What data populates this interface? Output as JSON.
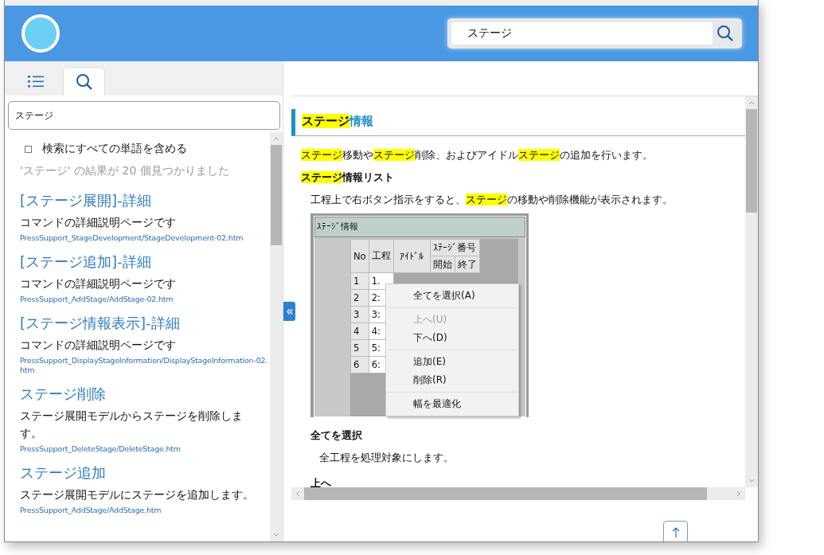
{
  "header": {
    "search": {
      "value": "ステージ"
    }
  },
  "sidebar": {
    "tabs": [
      {
        "kind": "contents",
        "selected": false
      },
      {
        "kind": "search",
        "selected": true
      }
    ],
    "search_field": {
      "value": "ステージ"
    },
    "all_words": {
      "label": "検索にすべての単語を含める",
      "checked": false
    },
    "result_count": "'ステージ' の結果が 20 個見つかりました",
    "results": [
      {
        "title": "[ステージ展開]-詳細",
        "description": "コマンドの詳細説明ページです",
        "path": "PressSupport_StageDevelopment/StageDevelopment-02.htm"
      },
      {
        "title": "[ステージ追加]-詳細",
        "description": "コマンドの詳細説明ページです",
        "path": "PressSupport_AddStage/AddStage-02.htm"
      },
      {
        "title": "[ステージ情報表示]-詳細",
        "description": "コマンドの詳細説明ページです",
        "path": "PressSupport_DisplayStageInformation/DisplayStageInformation-02.htm"
      },
      {
        "title": "ステージ削除",
        "description": "ステージ展開モデルからステージを削除します。",
        "path": "PressSupport_DeleteStage/DeleteStage.htm"
      },
      {
        "title": "ステージ追加",
        "description": "ステージ展開モデルにステージを追加します。",
        "path": "PressSupport_AddStage/AddStage.htm"
      }
    ]
  },
  "article": {
    "heading": [
      {
        "text": "ステージ",
        "highlight": true
      },
      {
        "text": "情報",
        "highlight": false
      }
    ],
    "intro": [
      {
        "text": "ステージ",
        "highlight": true
      },
      {
        "text": "移動や",
        "highlight": false
      },
      {
        "text": "ステージ",
        "highlight": true
      },
      {
        "text": "削除、およびアイドル",
        "highlight": false
      },
      {
        "text": "ステージ",
        "highlight": true
      },
      {
        "text": "の追加を行います。",
        "highlight": false
      }
    ],
    "subheading": [
      {
        "text": "ステージ",
        "highlight": true
      },
      {
        "text": "情報リスト",
        "highlight": false
      }
    ],
    "sub_text": [
      {
        "text": "工程上で右ボタン指示をすると、",
        "highlight": false
      },
      {
        "text": "ステージ",
        "highlight": true
      },
      {
        "text": "の移動や削除機能が表示されます。",
        "highlight": false
      }
    ],
    "screenshot": {
      "title": "ｽﾃｰｼﾞ情報",
      "columns": {
        "no": "No",
        "process": "工程",
        "idle": "ｱｲﾄﾞﾙ",
        "stage_number": "ｽﾃｰｼﾞ番号",
        "start": "開始",
        "end": "終了"
      },
      "rows": [
        {
          "no": "1",
          "process": "1."
        },
        {
          "no": "2",
          "process": "2:"
        },
        {
          "no": "3",
          "process": "3:"
        },
        {
          "no": "4",
          "process": "4:"
        },
        {
          "no": "5",
          "process": "5:"
        },
        {
          "no": "6",
          "process": "6:"
        }
      ],
      "menu": [
        [
          {
            "label": "全てを選択(A)",
            "disabled": false
          }
        ],
        [
          {
            "label": "上へ(U)",
            "disabled": true
          },
          {
            "label": "下へ(D)",
            "disabled": false
          }
        ],
        [
          {
            "label": "追加(E)",
            "disabled": false
          },
          {
            "label": "削除(R)",
            "disabled": false
          }
        ],
        [
          {
            "label": "幅を最適化",
            "disabled": false
          }
        ]
      ]
    },
    "sections": [
      {
        "title": "全てを選択",
        "text": "全工程を処理対象にします。"
      },
      {
        "title": "上へ"
      }
    ]
  }
}
